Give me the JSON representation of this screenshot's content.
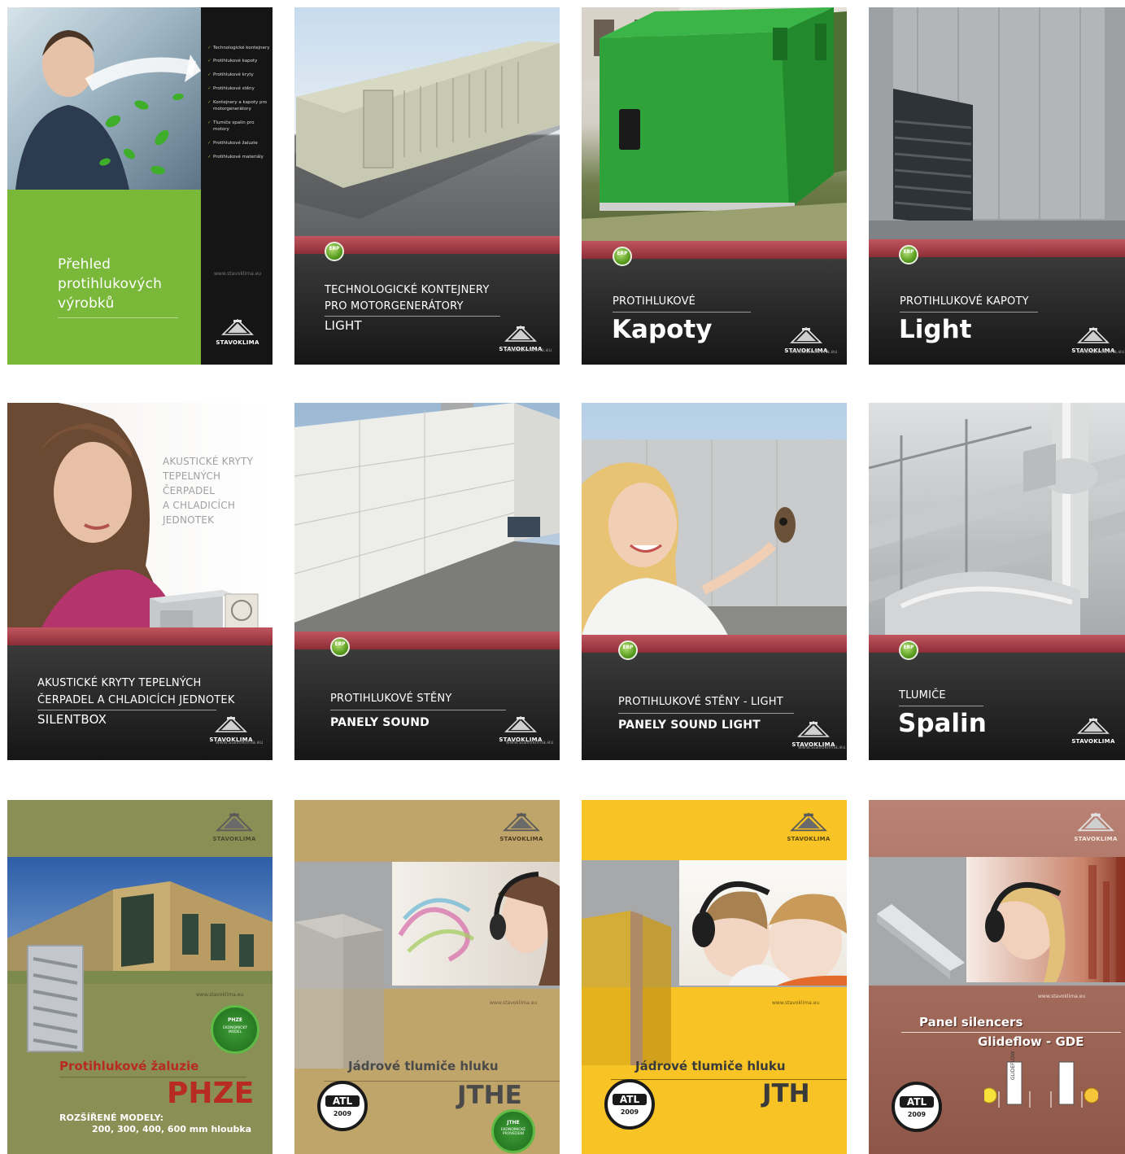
{
  "covers": {
    "c1": {
      "menu": [
        "Technologické kontejnery",
        "Protihlukové kapoty",
        "Protihlukové kryty",
        "Protihlukové stěny",
        "Kontejnery a kapoty pro motorgenerátory",
        "Tlumiče spalin pro motory",
        "Protihlukové žaluzie",
        "Protihlukové materiály"
      ],
      "title_l1": "Přehled",
      "title_l2": "protihlukových",
      "title_l3": "výrobků",
      "url": "www.stavoklima.eu",
      "logo": "STAVOKLIMA"
    },
    "c2": {
      "line1": "TECHNOLOGICKÉ KONTEJNERY",
      "line2": "PRO MOTORGENERÁTORY",
      "line3": "LIGHT",
      "erp": "ERP",
      "logo": "STAVOKLIMA",
      "url": "www.stavoklima.eu"
    },
    "c3": {
      "line1": "PROTIHLUKOVÉ",
      "line2": "Kapoty",
      "erp": "ERP",
      "logo": "STAVOKLIMA",
      "url": "www.stavoklima.eu"
    },
    "c4": {
      "line1": "PROTIHLUKOVÉ KAPOTY",
      "line2": "Light",
      "erp": "ERP",
      "logo": "STAVOKLIMA",
      "url": "www.stavoklima.eu"
    },
    "c5": {
      "side1": "AKUSTICKÉ KRYTY",
      "side2": "TEPELNÝCH",
      "side3": "ČERPADEL",
      "side4": "A CHLADICÍCH",
      "side5": "JEDNOTEK",
      "line1": "AKUSTICKÉ KRYTY TEPELNÝCH",
      "line2": "ČERPADEL A CHLADICÍCH JEDNOTEK",
      "line3": "SILENTBOX",
      "logo": "STAVOKLIMA",
      "url": "www.stavoklima.eu"
    },
    "c6": {
      "line1": "PROTIHLUKOVÉ STĚNY",
      "line2": "PANELY SOUND",
      "erp": "ERP",
      "logo": "STAVOKLIMA",
      "url": "www.stavoklima.eu"
    },
    "c7": {
      "line1": "PROTIHLUKOVÉ STĚNY - LIGHT",
      "line2": "PANELY SOUND LIGHT",
      "erp": "ERP",
      "logo": "STAVOKLIMA",
      "url": "www.stavoklima.eu"
    },
    "c8": {
      "line1": "TLUMIČE",
      "line2": "Spalin",
      "erp": "ERP",
      "logo": "STAVOKLIMA",
      "url": "www.stavoklima.eu"
    },
    "c9": {
      "logo": "STAVOKLIMA",
      "url": "www.stavoklima.eu",
      "seal1": "PHZE",
      "seal2": "EKONOMICKÝ",
      "seal3": "MODEL",
      "title": "Protihlukové žaluzie",
      "model": "PHZE",
      "ext1": "ROZŠÍŘENÉ MODELY:",
      "ext2": "200, 300, 400, 600 mm hloubka"
    },
    "c10": {
      "logo": "STAVOKLIMA",
      "url": "www.stavoklima.eu",
      "title": "Jádrové tlumiče hluku",
      "model": "JTHE",
      "atl": "ATL",
      "year": "2009",
      "seal1": "JTHE",
      "seal2": "EKONOMICKÉ",
      "seal3": "PROVEDENÍ"
    },
    "c11": {
      "logo": "STAVOKLIMA",
      "url": "www.stavoklima.eu",
      "title": "Jádrové tlumiče hluku",
      "model": "JTH",
      "atl": "ATL",
      "year": "2009"
    },
    "c12": {
      "logo": "STAVOKLIMA",
      "url": "www.stavoklima.eu",
      "title1": "Panel silencers",
      "title2": "Glideflow - GDE",
      "atl": "ATL",
      "year": "2009",
      "label": "GLIDEFLOW"
    }
  },
  "colors": {
    "green": "#7ab83a",
    "dark": "#1e1e1e",
    "red": "#9c3a43",
    "olive": "#8a8f55",
    "tan": "#c0a56a",
    "yellow": "#f7c325",
    "copper": "#a8695a"
  }
}
